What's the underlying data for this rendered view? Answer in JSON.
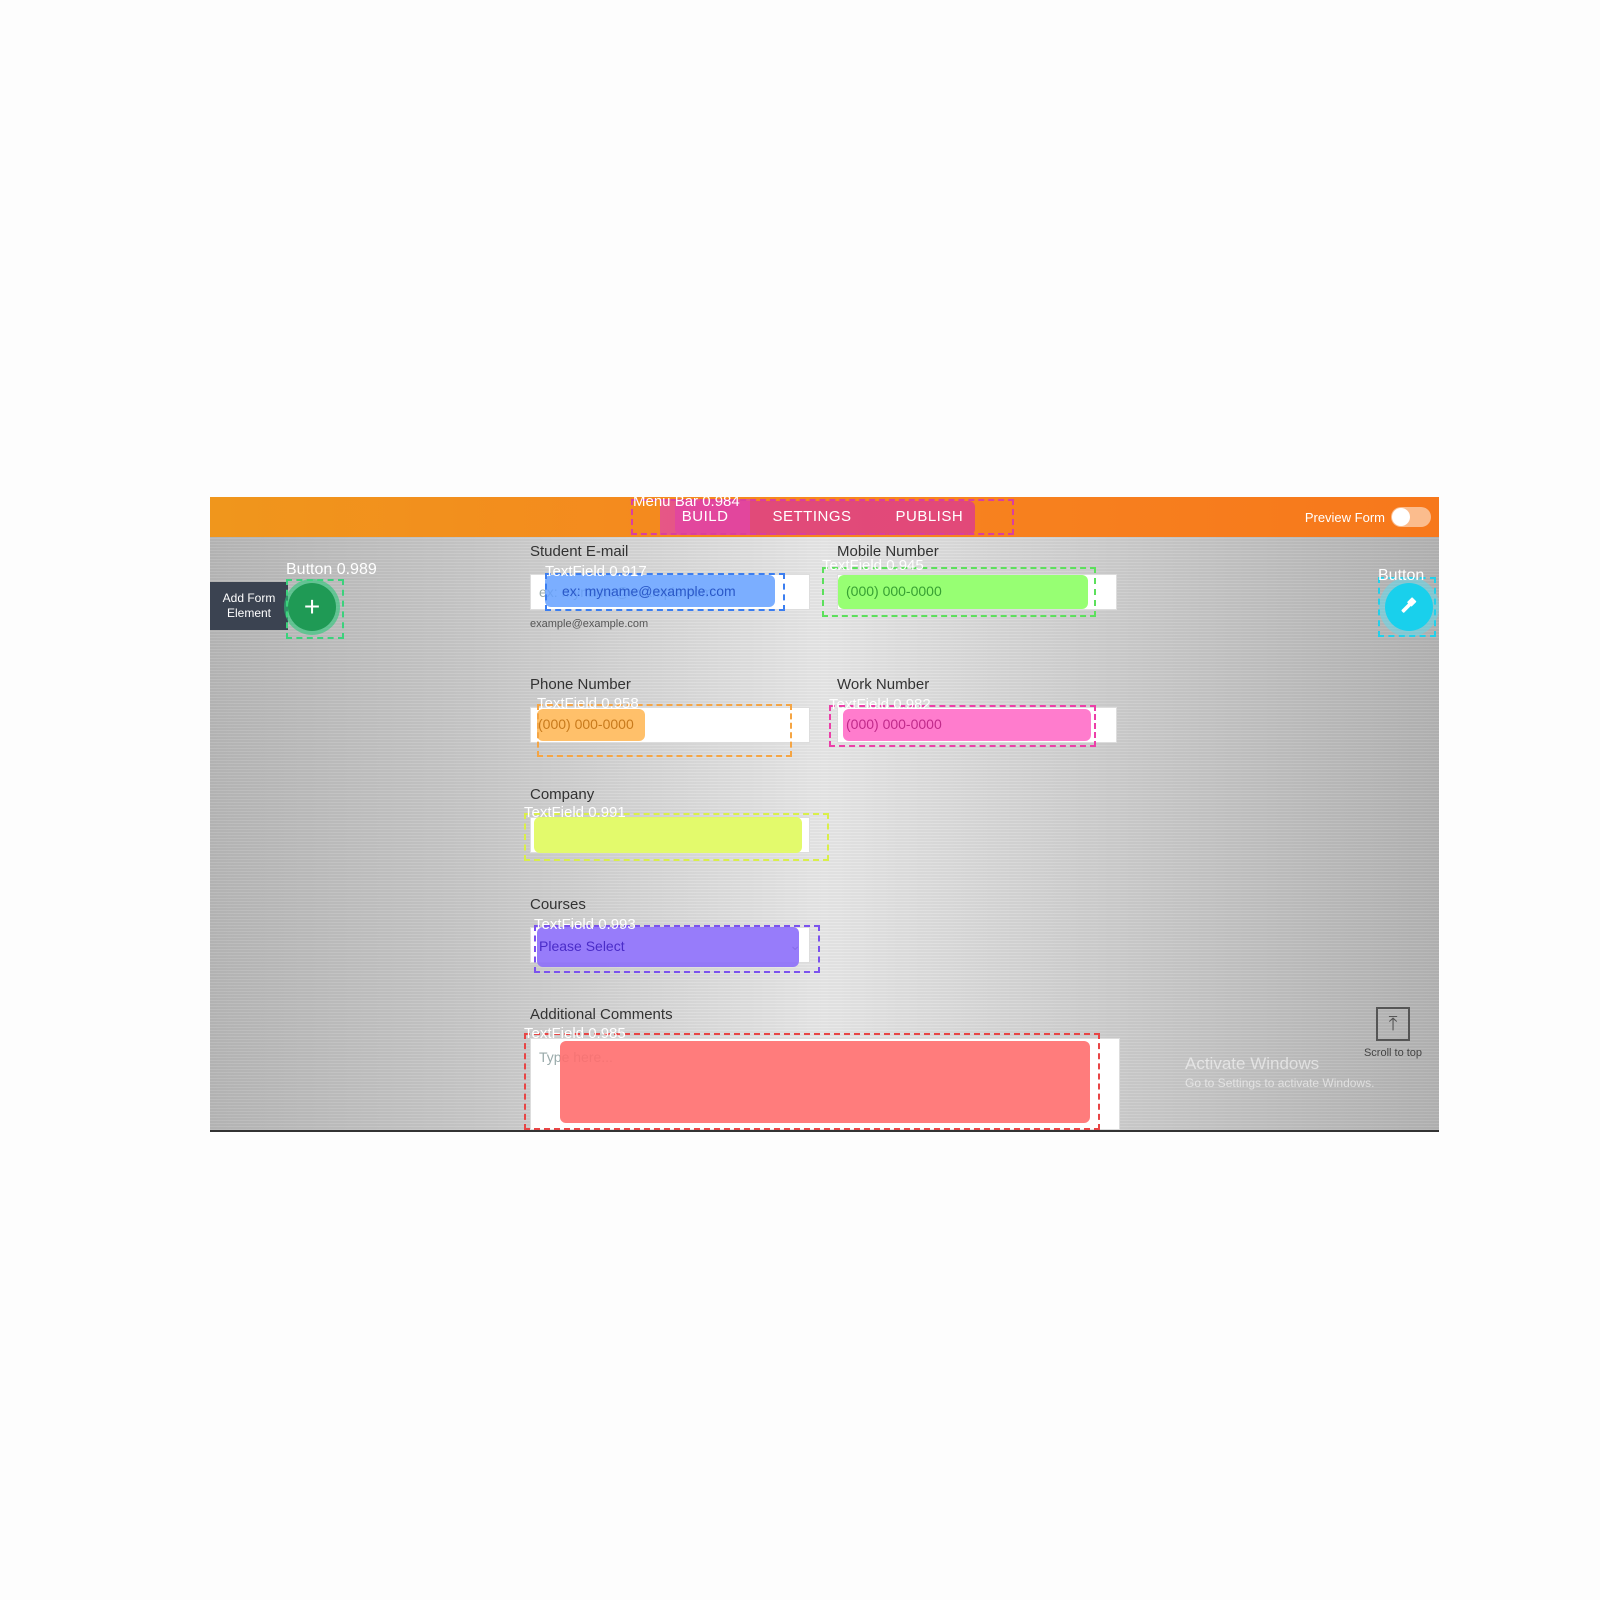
{
  "header": {
    "menu_tag": "Menu Bar 0.984",
    "tabs": [
      "BUILD",
      "SETTINGS",
      "PUBLISH"
    ],
    "preview_label": "Preview Form",
    "colors": {
      "accent": "#f7821f",
      "menu_highlight": "#d93fa0"
    }
  },
  "sidebar": {
    "add_form_label": "Add Form Element",
    "add_button_tag": "Button 0.989",
    "add_icon": "plus-icon",
    "right_button_tag": "Button",
    "right_icon": "hammer-icon"
  },
  "form": {
    "email": {
      "label": "Student E-mail",
      "placeholder": "ex: myname@example.com",
      "hint": "example@example.com",
      "tag": "TextField 0.917"
    },
    "mobile": {
      "label": "Mobile Number",
      "placeholder": "(000) 000-0000",
      "tag": "TextField 0.945"
    },
    "phone": {
      "label": "Phone Number",
      "placeholder": "(000) 000-0000",
      "tag": "TextField 0.958"
    },
    "work": {
      "label": "Work Number",
      "placeholder": "(000) 000-0000",
      "tag": "TextField 0.982"
    },
    "company": {
      "label": "Company",
      "placeholder": "",
      "tag": "TextField 0.991"
    },
    "courses": {
      "label": "Courses",
      "value": "Please Select",
      "tag": "TextField 0.993"
    },
    "comments": {
      "label": "Additional Comments",
      "placeholder": "Type here...",
      "tag": "TextField 0.985"
    }
  },
  "footer": {
    "scroll_label": "Scroll to top",
    "scroll_icon": "arrow-up-icon",
    "activate_line1": "Activate Windows",
    "activate_line2": "Go to Settings to activate Windows."
  }
}
